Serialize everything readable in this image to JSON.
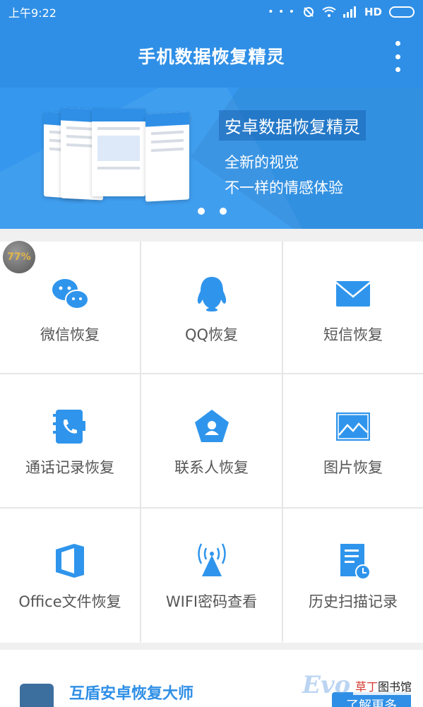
{
  "status_bar": {
    "time": "上午9:22",
    "network": "HD",
    "notif_dots": "• • •"
  },
  "app_bar": {
    "title": "手机数据恢复精灵"
  },
  "banner": {
    "headline": "安卓数据恢复精灵",
    "line1": "全新的视觉",
    "line2": "不一样的情感体验"
  },
  "badge": {
    "percent": "77%"
  },
  "grid": [
    {
      "label": "微信恢复",
      "icon": "wechat-icon"
    },
    {
      "label": "QQ恢复",
      "icon": "qq-icon"
    },
    {
      "label": "短信恢复",
      "icon": "sms-icon"
    },
    {
      "label": "通话记录恢复",
      "icon": "call-log-icon"
    },
    {
      "label": "联系人恢复",
      "icon": "contacts-icon"
    },
    {
      "label": "图片恢复",
      "icon": "image-icon"
    },
    {
      "label": "Office文件恢复",
      "icon": "office-icon"
    },
    {
      "label": "WIFI密码查看",
      "icon": "wifi-icon"
    },
    {
      "label": "历史扫描记录",
      "icon": "history-icon"
    }
  ],
  "bottom_card": {
    "title": "互盾安卓恢复大师",
    "button": "了解更多"
  },
  "watermark": {
    "brand": "Evo",
    "site_prefix": "草丁",
    "site_suffix": "图书馆"
  },
  "colors": {
    "primary": "#2f8fe6",
    "banner": "#3598ee",
    "text": "#555555"
  }
}
